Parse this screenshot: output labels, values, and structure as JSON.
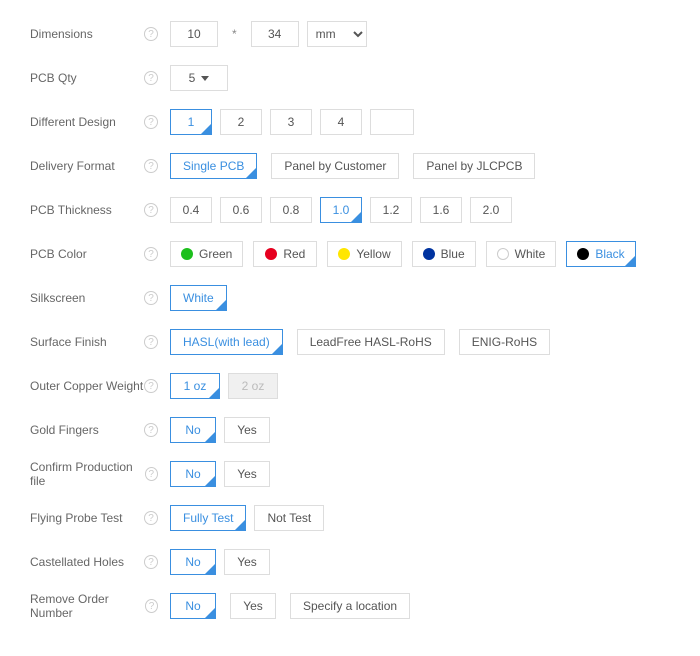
{
  "dimensions": {
    "label": "Dimensions",
    "width": "10",
    "height": "34",
    "unit": "mm"
  },
  "pcb_qty": {
    "label": "PCB Qty",
    "value": "5"
  },
  "different_design": {
    "label": "Different Design",
    "options": [
      "1",
      "2",
      "3",
      "4"
    ],
    "custom": ""
  },
  "delivery_format": {
    "label": "Delivery Format",
    "options": [
      "Single PCB",
      "Panel by Customer",
      "Panel by JLCPCB"
    ]
  },
  "pcb_thickness": {
    "label": "PCB Thickness",
    "options": [
      "0.4",
      "0.6",
      "0.8",
      "1.0",
      "1.2",
      "1.6",
      "2.0"
    ]
  },
  "pcb_color": {
    "label": "PCB Color",
    "options": [
      "Green",
      "Red",
      "Yellow",
      "Blue",
      "White",
      "Black"
    ]
  },
  "silkscreen": {
    "label": "Silkscreen",
    "options": [
      "White"
    ]
  },
  "surface_finish": {
    "label": "Surface Finish",
    "options": [
      "HASL(with lead)",
      "LeadFree HASL-RoHS",
      "ENIG-RoHS"
    ]
  },
  "outer_copper": {
    "label": "Outer Copper Weight",
    "options": [
      "1 oz",
      "2 oz"
    ]
  },
  "gold_fingers": {
    "label": "Gold Fingers",
    "options": [
      "No",
      "Yes"
    ]
  },
  "confirm_production": {
    "label": "Confirm Production file",
    "options": [
      "No",
      "Yes"
    ]
  },
  "flying_probe": {
    "label": "Flying Probe Test",
    "options": [
      "Fully Test",
      "Not Test"
    ]
  },
  "castellated": {
    "label": "Castellated Holes",
    "options": [
      "No",
      "Yes"
    ]
  },
  "remove_order_num": {
    "label": "Remove Order Number",
    "options": [
      "No",
      "Yes",
      "Specify a location"
    ]
  }
}
